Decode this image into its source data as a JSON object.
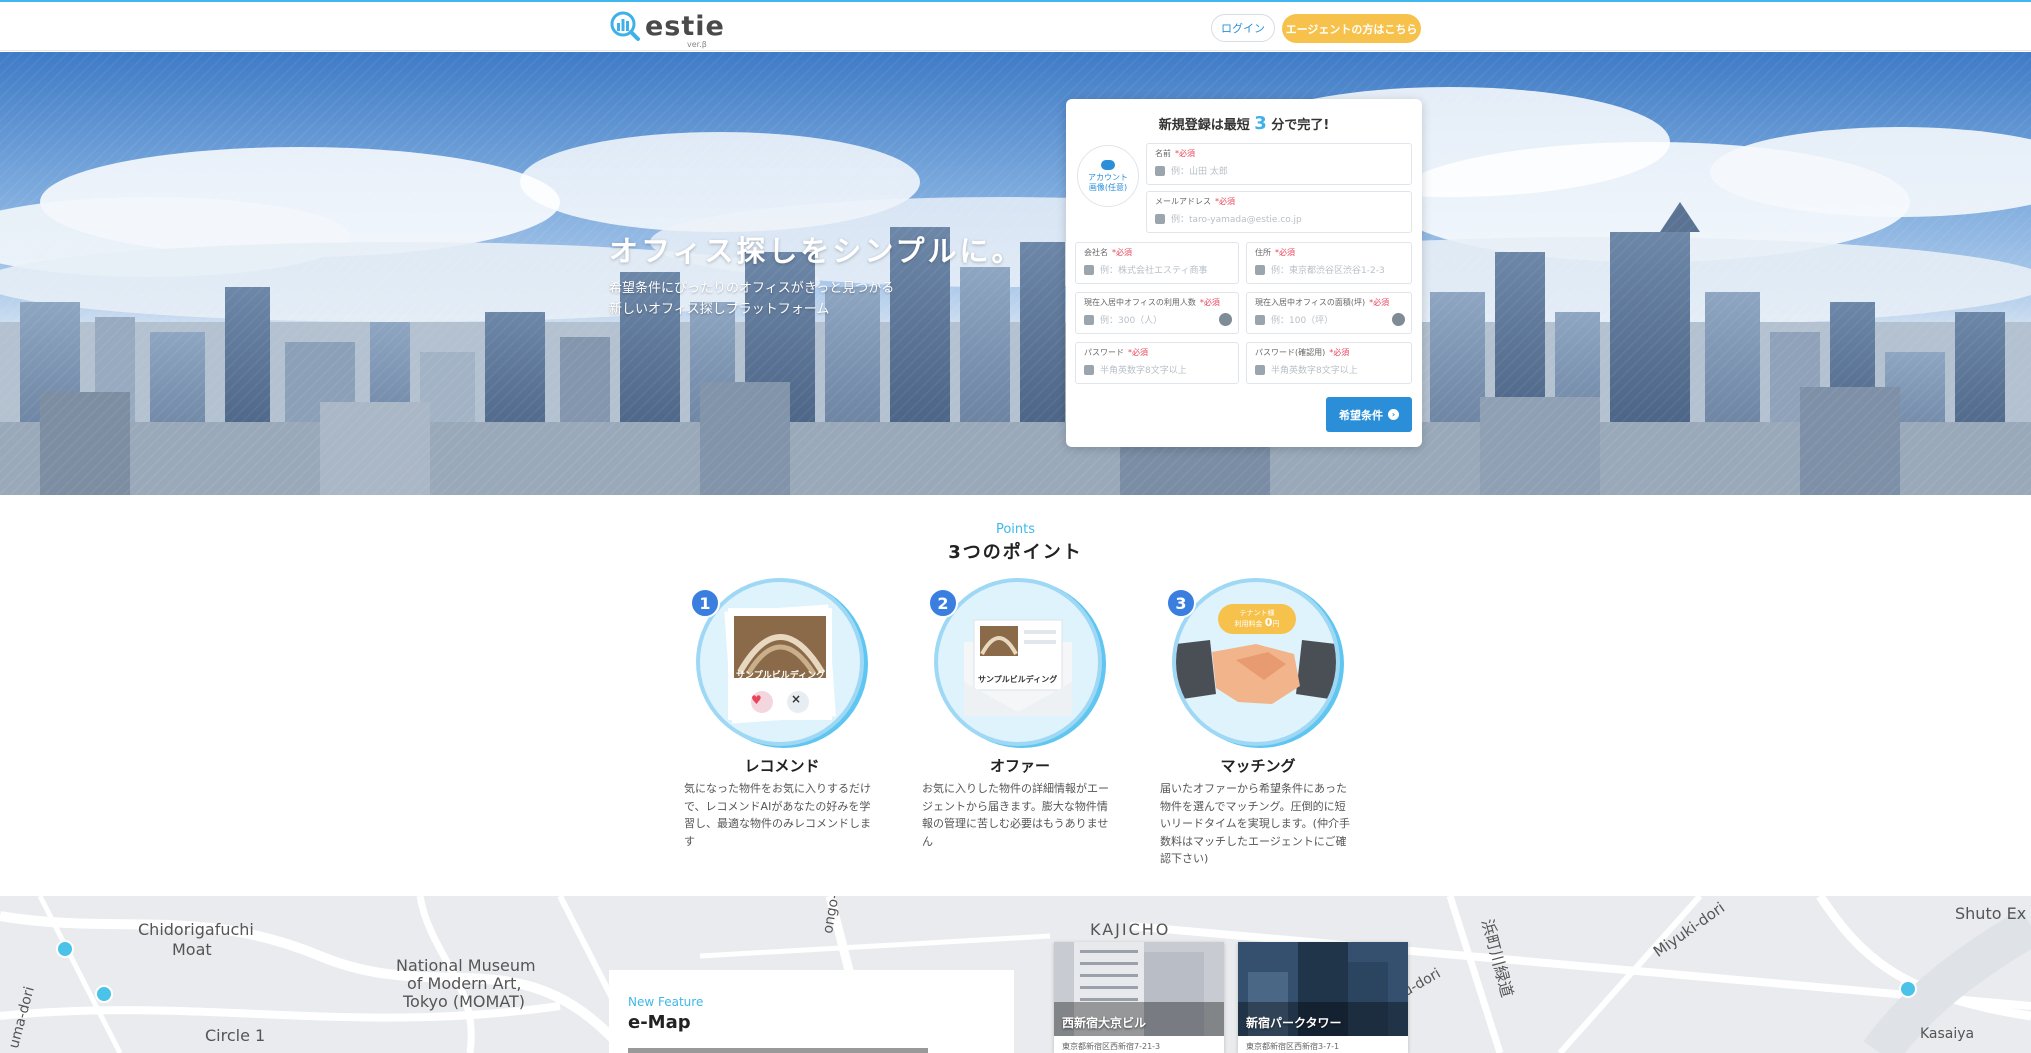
{
  "header": {
    "logo_text": "estie",
    "logo_version": "ver.β",
    "login_label": "ログイン",
    "agent_label": "エージェントの方はこちら"
  },
  "hero": {
    "title": "オフィス探しをシンプルに。",
    "subtitle_line1": "希望条件にぴったりのオフィスがきっと見つかる",
    "subtitle_line2": "新しいオフィス探しプラットフォーム"
  },
  "signup": {
    "title_prefix": "新規登録は最短",
    "title_num": "3",
    "title_suffix": "分で完了!",
    "avatar_line1": "アカウント",
    "avatar_line2": "画像(任意)",
    "required": "*必須",
    "fields": {
      "name": {
        "label": "名前",
        "placeholder": "例：山田 太郎"
      },
      "email": {
        "label": "メールアドレス",
        "placeholder": "例：taro-yamada@estie.co.jp"
      },
      "company": {
        "label": "会社名",
        "placeholder": "例：株式会社エスティ商事"
      },
      "address": {
        "label": "住所",
        "placeholder": "例：東京都渋谷区渋谷1-2-3"
      },
      "people": {
        "label": "現在入居中オフィスの利用人数",
        "placeholder": "例：300（人）"
      },
      "area": {
        "label": "現在入居中オフィスの面積(坪)",
        "placeholder": "例：100（坪）"
      },
      "password": {
        "label": "パスワード",
        "placeholder": "半角英数字8文字以上"
      },
      "password_confirm": {
        "label": "パスワード(確認用)",
        "placeholder": "半角英数字8文字以上"
      }
    },
    "next_label": "希望条件"
  },
  "points": {
    "label_en": "Points",
    "title": "3つのポイント",
    "items": [
      {
        "num": "1",
        "name": "レコメンド",
        "card_label": "サンプルビルディング",
        "desc": "気になった物件をお気に入りするだけで、レコメンドAIがあなたの好みを学習し、最適な物件のみレコメンドします"
      },
      {
        "num": "2",
        "name": "オファー",
        "card_label": "サンプルビルディング",
        "desc": "お気に入りした物件の詳細情報がエージェントから届きます。膨大な物件情報の管理に苦しむ必要はもうありません"
      },
      {
        "num": "3",
        "name": "マッチング",
        "badge_line1": "テナント様",
        "badge_line2": "利用料金",
        "badge_value": "0",
        "badge_unit": "円",
        "desc": "届いたオファーから希望条件にあった物件を選んでマッチング。圧倒的に短いリードタイムを実現します。(仲介手数料はマッチしたエージェントにご確認下さい)"
      }
    ]
  },
  "map": {
    "labels": {
      "chidorigafuchi": "Chidorigafuchi",
      "moat": "Moat",
      "museum1": "National Museum",
      "museum2": "of Modern Art,",
      "museum3": "Tokyo (MOMAT)",
      "circle": "Circle 1",
      "kajicho": "KAJICHO",
      "ongo": "ongo-dori",
      "uma": "uma-dori",
      "hamacho": "浜町川緑道",
      "miyuki": "Miyuki-dori",
      "udori": "u-dori",
      "shuto": "Shuto Ex",
      "kasaiya": "Kasaiya"
    },
    "feature_en": "New Feature",
    "feature_title": "e-Map",
    "buildings": [
      {
        "name": "西新宿大京ビル",
        "address": "東京都新宿区西新宿7-21-3"
      },
      {
        "name": "新宿パークタワー",
        "address": "東京都新宿区西新宿3-7-1"
      }
    ]
  }
}
